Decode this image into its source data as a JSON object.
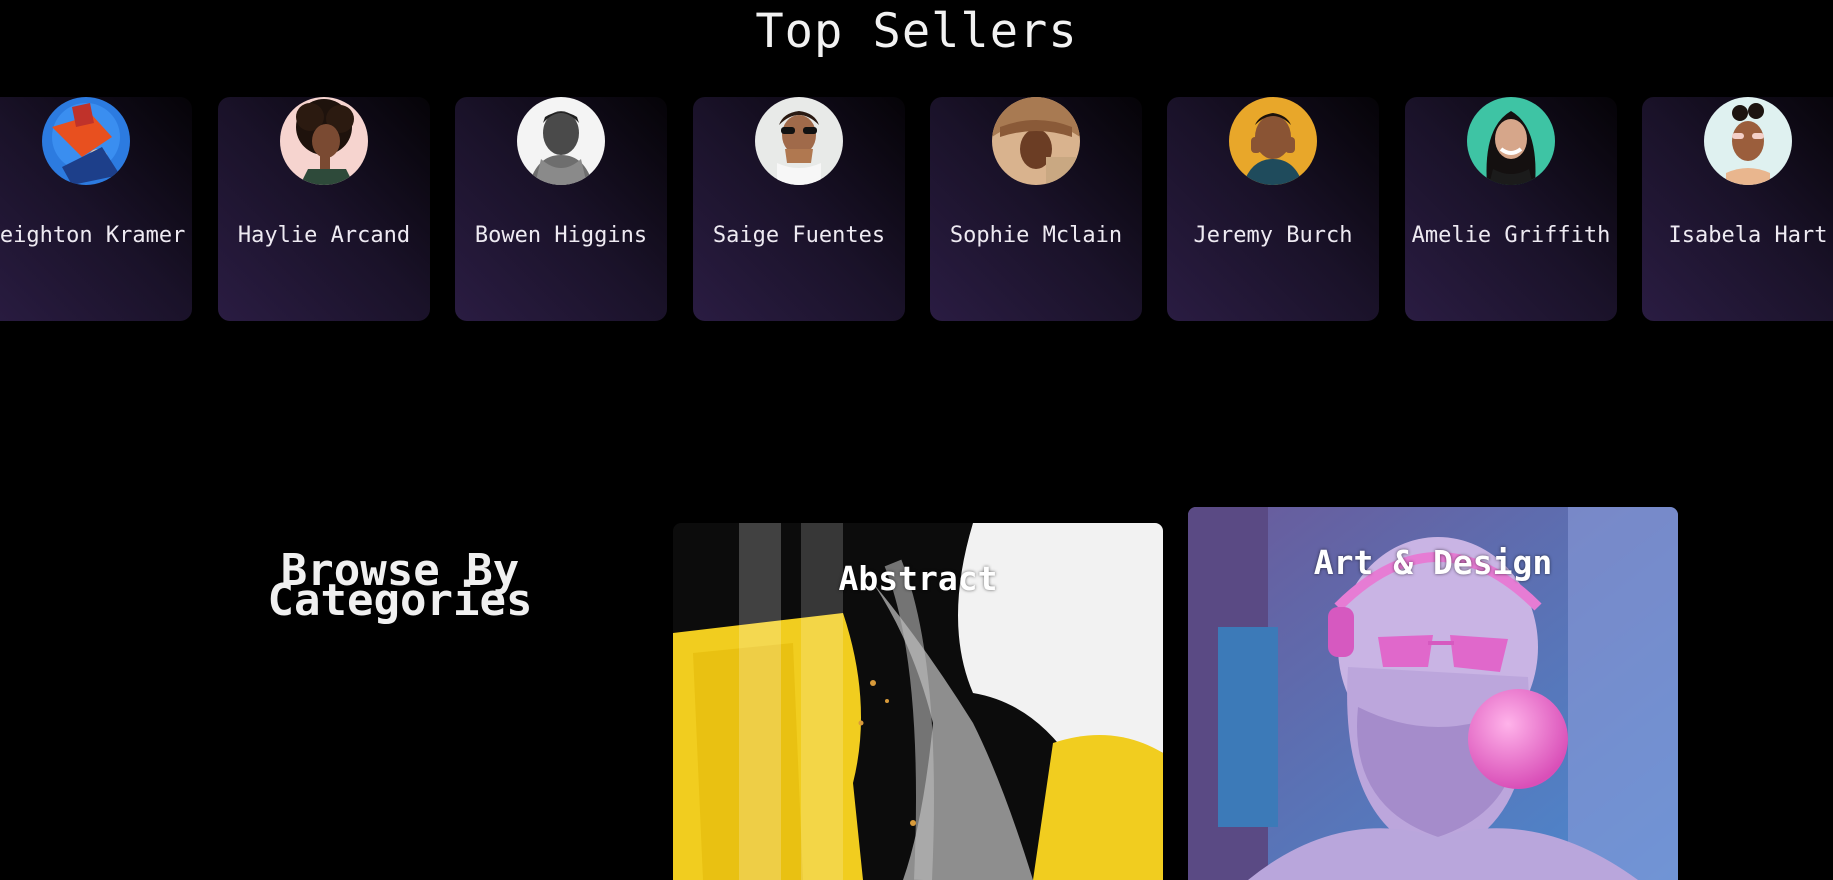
{
  "top_sellers": {
    "title": "Top Sellers",
    "sellers": [
      {
        "name": "Leighton Kramer",
        "avatar": "avatar-photo"
      },
      {
        "name": "Haylie Arcand",
        "avatar": "avatar-photo"
      },
      {
        "name": "Bowen Higgins",
        "avatar": "avatar-photo"
      },
      {
        "name": "Saige Fuentes",
        "avatar": "avatar-photo"
      },
      {
        "name": "Sophie Mclain",
        "avatar": "avatar-photo"
      },
      {
        "name": "Jeremy Burch",
        "avatar": "avatar-photo"
      },
      {
        "name": "Amelie Griffith",
        "avatar": "avatar-photo"
      },
      {
        "name": "Isabela Hart",
        "avatar": "avatar-photo"
      }
    ]
  },
  "categories": {
    "title_line1": "Browse By",
    "title_line2": "Categories",
    "items": [
      {
        "label": "Abstract"
      },
      {
        "label": "Art & Design"
      }
    ]
  },
  "colors": {
    "background": "#000000",
    "card_gradient_start": "#2a1c42",
    "card_gradient_end": "#050307",
    "text": "#ffffff"
  }
}
